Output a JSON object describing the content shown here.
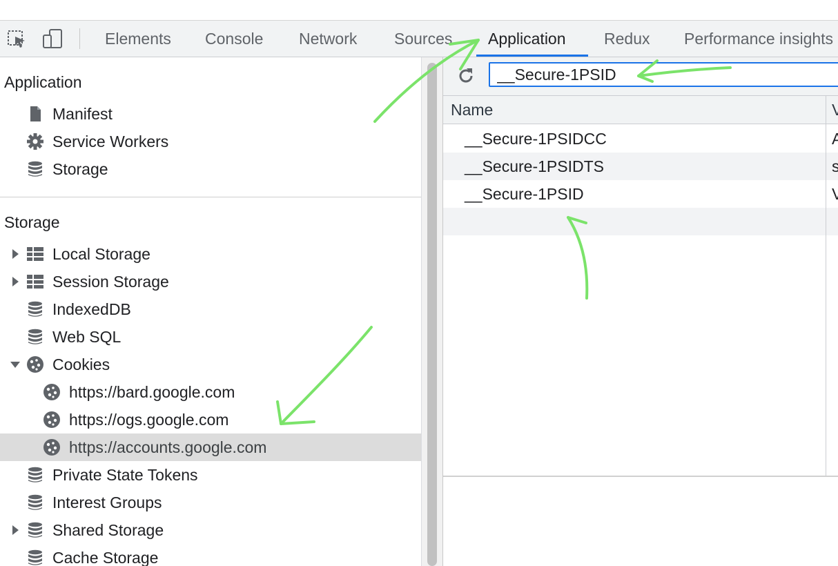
{
  "toolbar": {
    "inspect_icon": "inspect-element-icon",
    "device_icon": "device-toolbar-icon"
  },
  "tabs": [
    {
      "label": "Elements"
    },
    {
      "label": "Console"
    },
    {
      "label": "Network"
    },
    {
      "label": "Sources"
    },
    {
      "label": "Application",
      "active": true
    },
    {
      "label": "Redux"
    },
    {
      "label": "Performance insights"
    }
  ],
  "sidebar": {
    "application_title": "Application",
    "application_items": [
      {
        "label": "Manifest",
        "icon": "document-icon"
      },
      {
        "label": "Service Workers",
        "icon": "gear-icon"
      },
      {
        "label": "Storage",
        "icon": "database-icon"
      }
    ],
    "storage_title": "Storage",
    "storage_items": [
      {
        "label": "Local Storage",
        "icon": "table-icon",
        "expandable": "collapsed"
      },
      {
        "label": "Session Storage",
        "icon": "table-icon",
        "expandable": "collapsed"
      },
      {
        "label": "IndexedDB",
        "icon": "database-icon"
      },
      {
        "label": "Web SQL",
        "icon": "database-icon"
      },
      {
        "label": "Cookies",
        "icon": "cookie-icon",
        "expandable": "expanded"
      },
      {
        "label": "https://bard.google.com",
        "icon": "cookie-icon",
        "child": true
      },
      {
        "label": "https://ogs.google.com",
        "icon": "cookie-icon",
        "child": true
      },
      {
        "label": "https://accounts.google.com",
        "icon": "cookie-icon",
        "child": true,
        "selected": true
      },
      {
        "label": "Private State Tokens",
        "icon": "database-icon"
      },
      {
        "label": "Interest Groups",
        "icon": "database-icon"
      },
      {
        "label": "Shared Storage",
        "icon": "database-icon",
        "expandable": "collapsed"
      },
      {
        "label": "Cache Storage",
        "icon": "database-icon"
      }
    ]
  },
  "cookies_panel": {
    "filter_value": "__Secure-1PSID",
    "columns": [
      "Name",
      "V"
    ],
    "rows": [
      {
        "name": "__Secure-1PSIDCC",
        "value": "A"
      },
      {
        "name": "__Secure-1PSIDTS",
        "value": "s"
      },
      {
        "name": "__Secure-1PSID",
        "value": "V"
      }
    ]
  },
  "colors": {
    "accent": "#1a73e8",
    "annotation": "#7be36a",
    "selected_row": "#dcdcdc"
  }
}
